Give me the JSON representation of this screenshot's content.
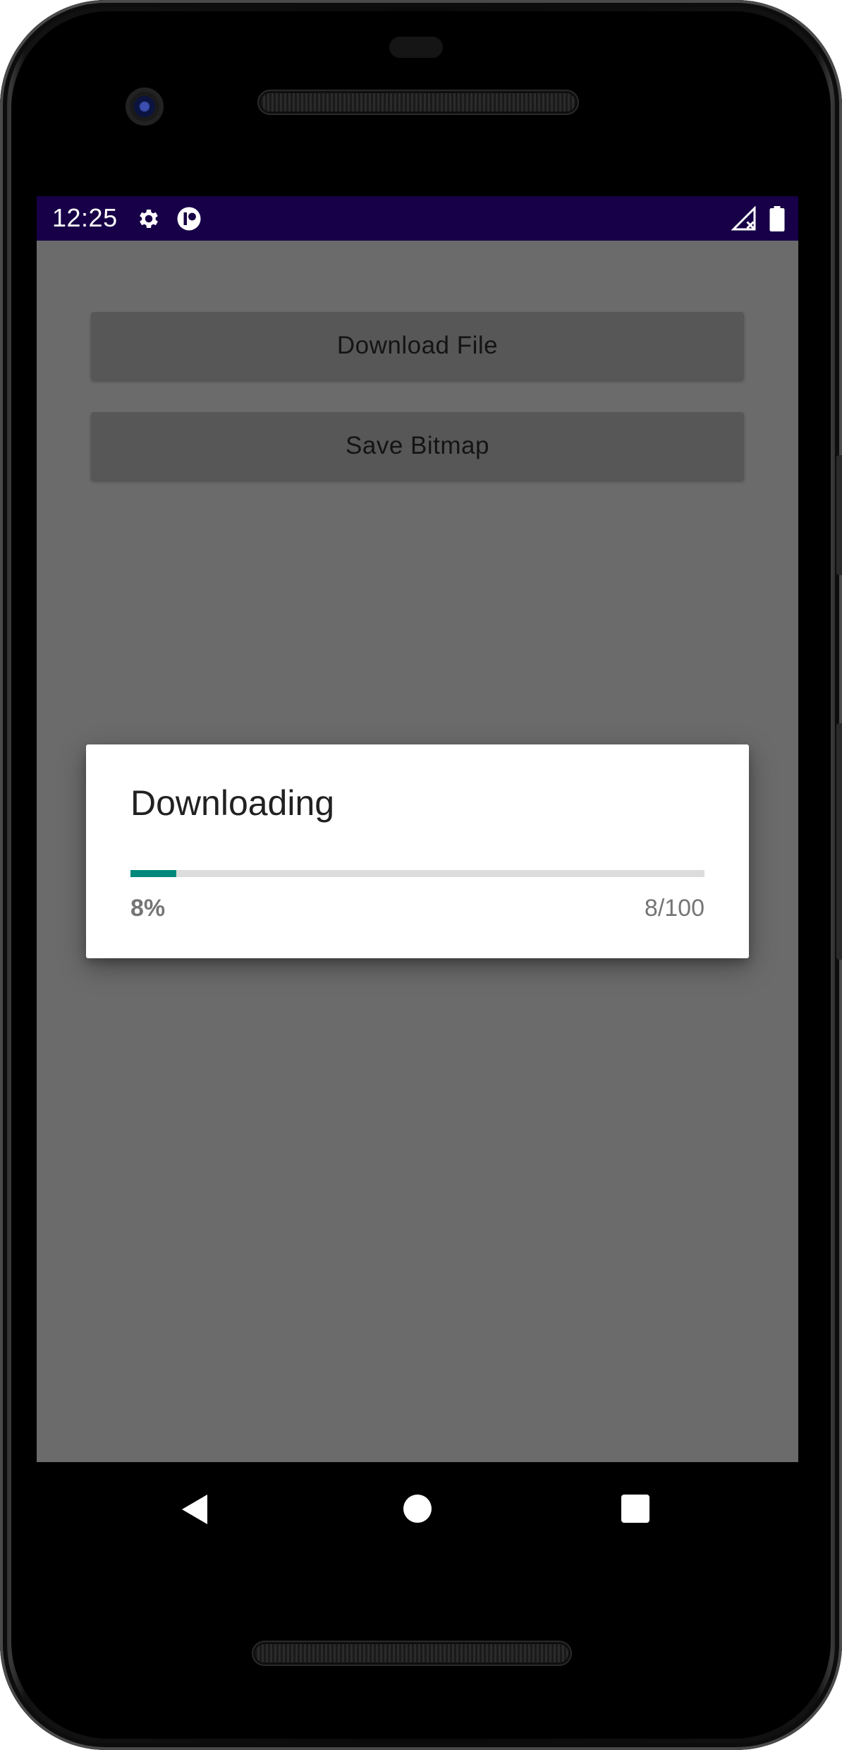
{
  "status_bar": {
    "time": "12:25",
    "icons": [
      "gear-icon",
      "app-notification-icon",
      "signal-no-data-icon",
      "battery-icon"
    ],
    "background_color": "#170047"
  },
  "buttons": {
    "download_label": "Download File",
    "save_label": "Save Bitmap"
  },
  "dialog": {
    "title": "Downloading",
    "progress": {
      "value": 8,
      "max": 100,
      "fraction": 0.08,
      "percent_text": "8%",
      "count_text": "8/100",
      "fill_color": "#00897b"
    }
  },
  "navigation": {
    "icons": [
      "back-icon",
      "home-icon",
      "recents-icon"
    ]
  }
}
